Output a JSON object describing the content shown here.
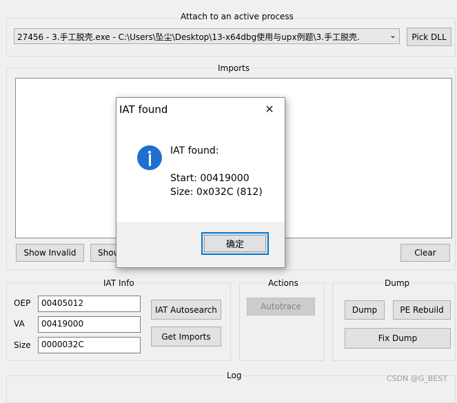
{
  "attach": {
    "legend": "Attach to an active process",
    "process_value": "27456 - 3.手工脱壳.exe - C:\\Users\\坠尘\\Desktop\\13-x64dbg使用与upx例题\\3.手工脱壳.",
    "pick_dll_label": "Pick DLL"
  },
  "imports": {
    "legend": "Imports",
    "show_invalid_label": "Show Invalid",
    "show_suspect_label": "Show",
    "clear_label": "Clear"
  },
  "iat_info": {
    "legend": "IAT Info",
    "oep_label": "OEP",
    "oep_value": "00405012",
    "va_label": "VA",
    "va_value": "00419000",
    "size_label": "Size",
    "size_value": "0000032C",
    "iat_autosearch_label": "IAT Autosearch",
    "get_imports_label": "Get Imports"
  },
  "actions": {
    "legend": "Actions",
    "autotrace_label": "Autotrace"
  },
  "dump": {
    "legend": "Dump",
    "dump_label": "Dump",
    "pe_rebuild_label": "PE Rebuild",
    "fix_dump_label": "Fix Dump"
  },
  "log": {
    "legend": "Log"
  },
  "dialog": {
    "title": "IAT found",
    "close_glyph": "✕",
    "heading": "IAT found:",
    "start_line": "Start: 00419000",
    "size_line": "Size: 0x032C (812)",
    "ok_label": "确定",
    "icon": "info-icon",
    "icon_color": "#1e6fd0"
  },
  "watermark": "CSDN @G_BEST"
}
